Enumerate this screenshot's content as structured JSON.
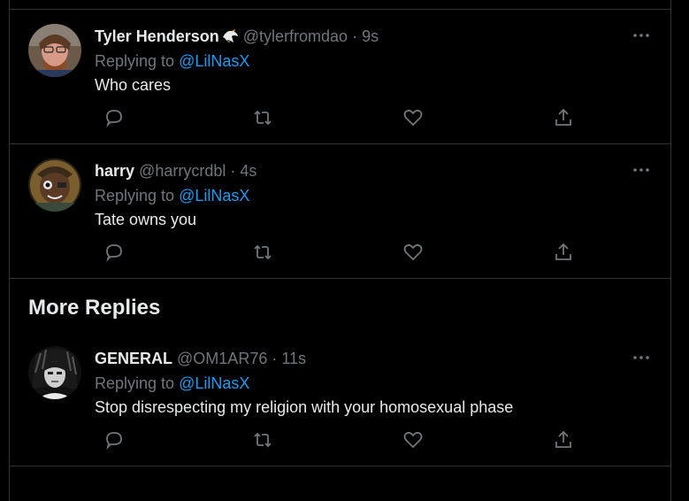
{
  "tweets": [
    {
      "name": "Tyler Henderson",
      "badge_icon": "eagle-emoji",
      "handle": "@tylerfromdao",
      "separator": "·",
      "time": "9s",
      "replying_prefix": "Replying to",
      "replying_to": "@LilNasX",
      "text": "Who cares"
    },
    {
      "name": "harry",
      "handle": "@harrycrdbl",
      "separator": "·",
      "time": "4s",
      "replying_prefix": "Replying to",
      "replying_to": "@LilNasX",
      "text": "Tate owns you"
    },
    {
      "name": "GENERAL",
      "handle": "@OM1AR76",
      "separator": "·",
      "time": "11s",
      "replying_prefix": "Replying to",
      "replying_to": "@LilNasX",
      "text": "Stop disrespecting my religion with your homosexual phase"
    }
  ],
  "section": {
    "more_replies": "More Replies"
  },
  "colors": {
    "background": "#000000",
    "text": "#e7e9ea",
    "muted": "#71767b",
    "link": "#1d9bf0",
    "border": "#2f3336"
  },
  "icons": {
    "reply": "reply-icon",
    "retweet": "retweet-icon",
    "like": "like-icon",
    "share": "share-icon",
    "more": "more-icon"
  }
}
